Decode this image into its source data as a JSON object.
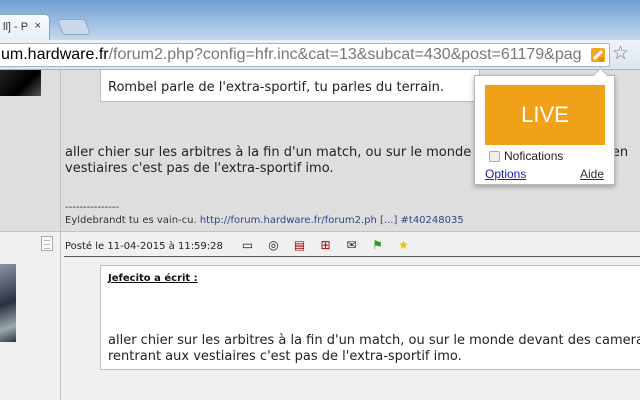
{
  "browser": {
    "tab_title": "ll] - P",
    "tab_close": "×",
    "url_host": "um.hardware.fr",
    "url_path": "/forum2.php?config=hfr.inc&cat=13&subcat=430&post=61179&pag",
    "star": "☆"
  },
  "post1": {
    "quote": "Rombel parle de l'extra-sportif, tu parles du terrain.",
    "body_line1": "aller chier sur les arbitres à la fin d'un match, ou sur le monde devant des cameras en",
    "body_line2": "vestiaires c'est pas de l'extra-sportif imo.",
    "sig_sep": "---------------",
    "sig_text": "Eyldebrandt tu es vain-cu.",
    "sig_link": "http://forum.hardware.fr/forum2.ph [...] #t40248035"
  },
  "post2": {
    "posted": "Posté le 11-04-2015 à 11:59:28",
    "icons": [
      "profile-icon",
      "message-icon",
      "quote-icon",
      "multiquote-icon",
      "email-icon",
      "alert-icon",
      "favorite-icon"
    ],
    "quote_author": "Jefecito a écrit :",
    "quote_line1": "aller chier sur les arbitres à la fin d'un match, ou sur le monde devant des cameras en",
    "quote_line2": "rentrant aux vestiaires c'est pas de l'extra-sportif imo."
  },
  "popup": {
    "live": "LIVE",
    "notifications": "Nofications",
    "options": "Options",
    "aide": "Aide",
    "accent": "#f0a117"
  }
}
